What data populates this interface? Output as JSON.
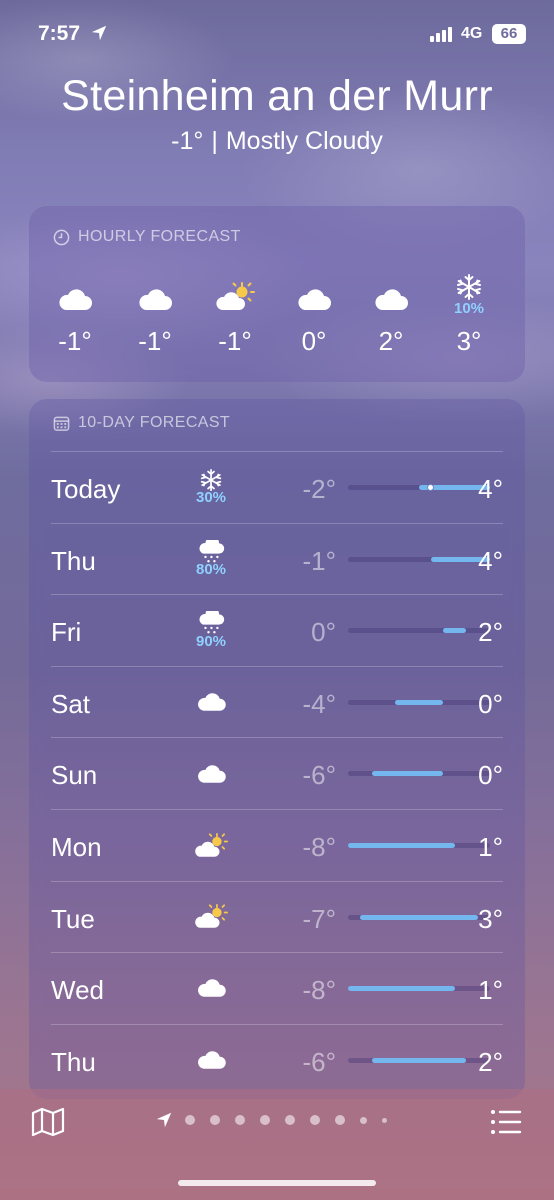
{
  "status": {
    "time": "7:57",
    "network": "4G",
    "battery": "66"
  },
  "location": {
    "city": "Steinheim an der Murr",
    "temp": "-1°",
    "separator": "|",
    "condition": "Mostly Cloudy"
  },
  "hourly": {
    "title": "HOURLY FORECAST",
    "hours": [
      {
        "icon": "cloud-icon",
        "precip": "",
        "temp": "-1°"
      },
      {
        "icon": "cloud-icon",
        "precip": "",
        "temp": "-1°"
      },
      {
        "icon": "partly-sunny-icon",
        "precip": "",
        "temp": "-1°"
      },
      {
        "icon": "cloud-icon",
        "precip": "",
        "temp": "0°"
      },
      {
        "icon": "cloud-icon",
        "precip": "",
        "temp": "2°"
      },
      {
        "icon": "snowflake-icon",
        "precip": "10%",
        "temp": "3°"
      }
    ]
  },
  "daily": {
    "title": "10-DAY FORECAST",
    "days": [
      {
        "day": "Today",
        "icon": "snowflake-icon",
        "precip": "30%",
        "low": "-2°",
        "high": "4°"
      },
      {
        "day": "Thu",
        "icon": "rain-icon",
        "precip": "80%",
        "low": "-1°",
        "high": "4°"
      },
      {
        "day": "Fri",
        "icon": "rain-icon",
        "precip": "90%",
        "low": "0°",
        "high": "2°"
      },
      {
        "day": "Sat",
        "icon": "cloud-icon",
        "precip": "",
        "low": "-4°",
        "high": "0°"
      },
      {
        "day": "Sun",
        "icon": "cloud-icon",
        "precip": "",
        "low": "-6°",
        "high": "0°"
      },
      {
        "day": "Mon",
        "icon": "partly-sunny-icon",
        "precip": "",
        "low": "-8°",
        "high": "1°"
      },
      {
        "day": "Tue",
        "icon": "partly-sunny-icon",
        "precip": "",
        "low": "-7°",
        "high": "3°"
      },
      {
        "day": "Wed",
        "icon": "cloud-icon",
        "precip": "",
        "low": "-8°",
        "high": "1°"
      },
      {
        "day": "Thu",
        "icon": "cloud-icon",
        "precip": "",
        "low": "-6°",
        "high": "2°"
      }
    ]
  },
  "colors": {
    "bar": "#74b7ee",
    "precip": "#8fd0ff"
  }
}
